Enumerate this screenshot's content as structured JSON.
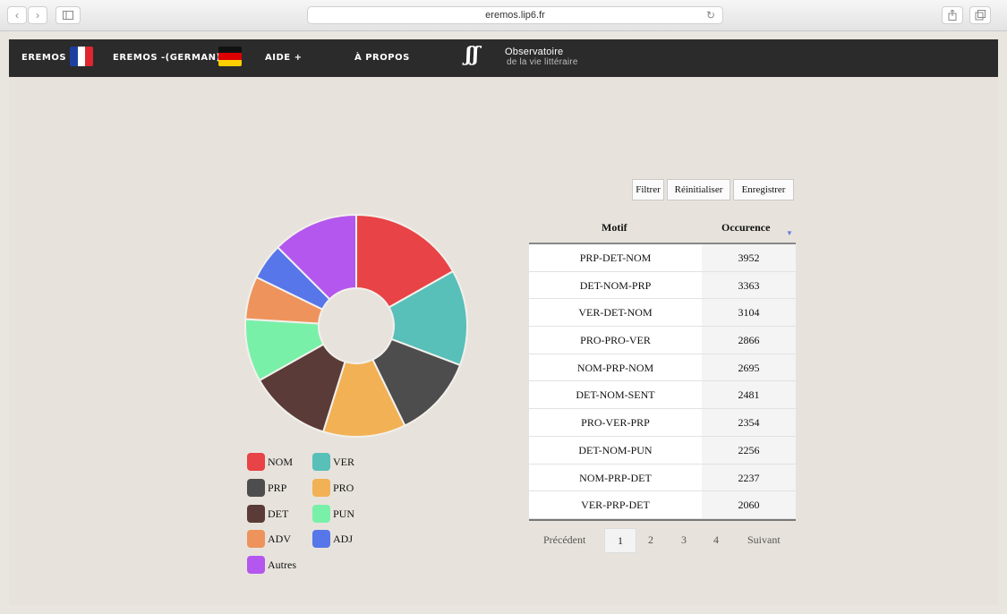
{
  "browser": {
    "url": "eremos.lip6.fr",
    "back_icon": "chevron-left-icon",
    "forward_icon": "chevron-right-icon",
    "sidebar_icon": "sidebar-icon",
    "reload_icon": "reload-icon",
    "share_icon": "share-icon",
    "tabs_icon": "tabs-icon"
  },
  "nav": {
    "eremos_label": "EREMOS",
    "eremos_german_label": "EREMOS -(GERMAN)",
    "aide_label": "AIDE +",
    "apropos_label": "À PROPOS",
    "logo_title": "Observatoire",
    "logo_subtitle": "de la vie littéraire"
  },
  "toolbar": {
    "filtrer": "Filtrer",
    "reinitialiser": "Réinitialiser",
    "enregistrer": "Enregistrer"
  },
  "table": {
    "headers": [
      "Motif",
      "Occurence"
    ],
    "rows": [
      {
        "motif": "PRP-DET-NOM",
        "occurence": "3952"
      },
      {
        "motif": "DET-NOM-PRP",
        "occurence": "3363"
      },
      {
        "motif": "VER-DET-NOM",
        "occurence": "3104"
      },
      {
        "motif": "PRO-PRO-VER",
        "occurence": "2866"
      },
      {
        "motif": "NOM-PRP-NOM",
        "occurence": "2695"
      },
      {
        "motif": "DET-NOM-SENT",
        "occurence": "2481"
      },
      {
        "motif": "PRO-VER-PRP",
        "occurence": "2354"
      },
      {
        "motif": "DET-NOM-PUN",
        "occurence": "2256"
      },
      {
        "motif": "NOM-PRP-DET",
        "occurence": "2237"
      },
      {
        "motif": "VER-PRP-DET",
        "occurence": "2060"
      }
    ]
  },
  "pagination": {
    "prev": "Précédent",
    "pages": [
      "1",
      "2",
      "3",
      "4"
    ],
    "current": "1",
    "next": "Suivant"
  },
  "chart_data": {
    "type": "pie",
    "donut": true,
    "categories": [
      "NOM",
      "VER",
      "PRP",
      "PRO",
      "DET",
      "PUN",
      "ADV",
      "ADJ",
      "Autres"
    ],
    "values": [
      17.5,
      14.5,
      12.5,
      12.5,
      12.5,
      9.5,
      6.5,
      5.5,
      13.0
    ],
    "colors": [
      "#e84346",
      "#58bfb9",
      "#4d4d4d",
      "#f2b154",
      "#5a3b38",
      "#79f0a8",
      "#ee935c",
      "#5776ea",
      "#b457ee"
    ],
    "legend_placement": "bottom",
    "title": ""
  }
}
